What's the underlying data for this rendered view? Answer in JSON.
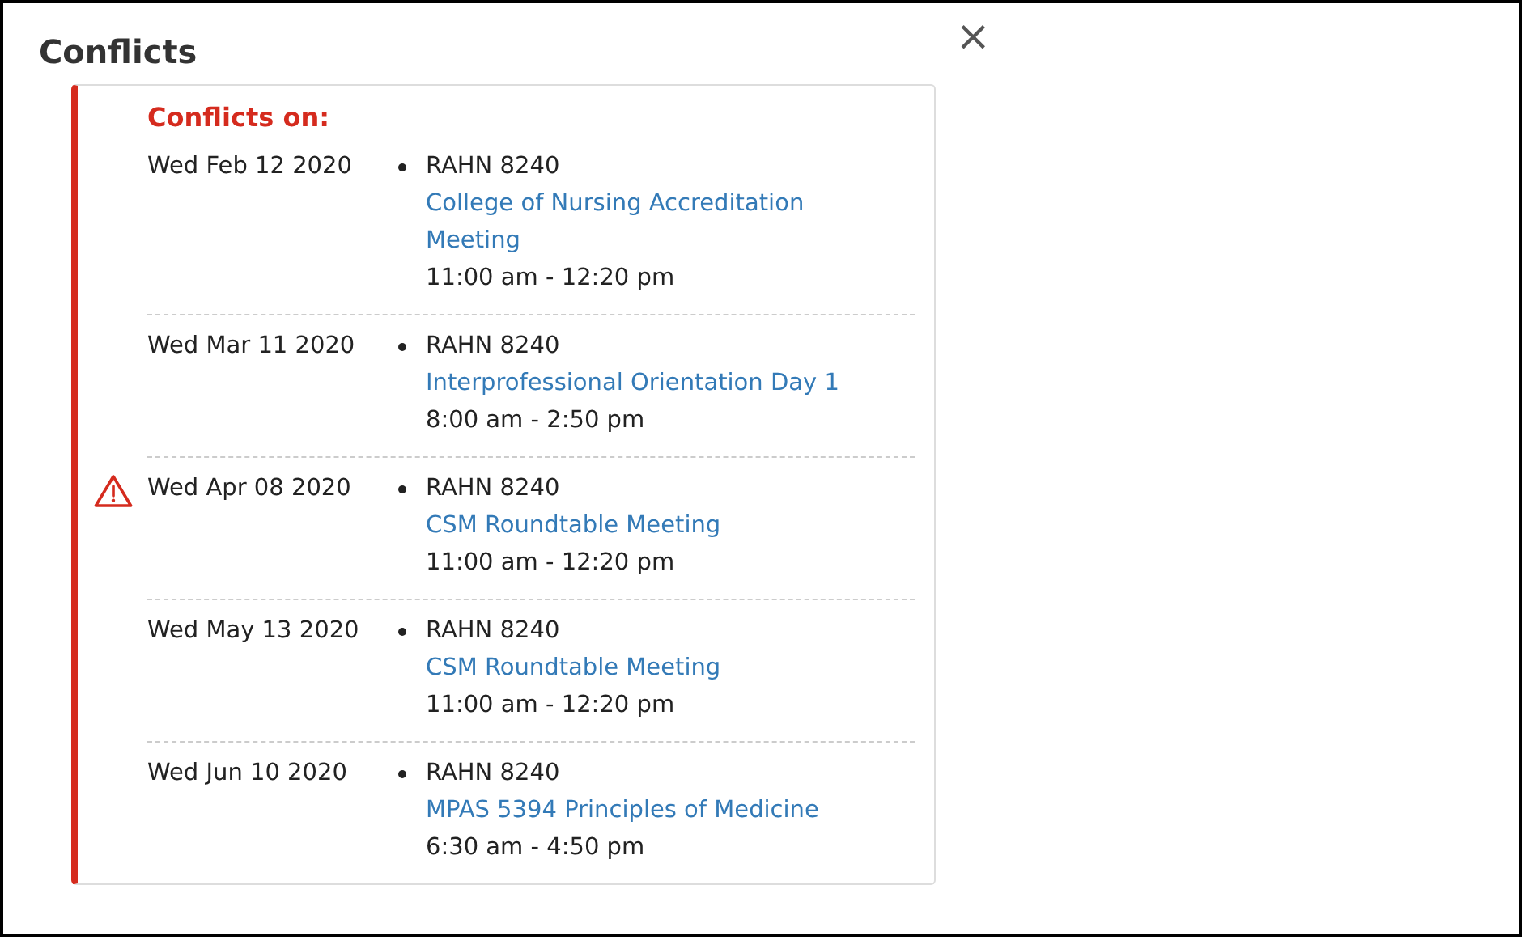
{
  "dialog": {
    "title": "Conflicts",
    "close": "×"
  },
  "conflicts": {
    "heading": "Conflicts on:",
    "rows": [
      {
        "date": "Wed Feb 12 2020",
        "warning": false,
        "location": "RAHN 8240",
        "event": "College of Nursing Accreditation Meeting",
        "time": "11:00 am - 12:20 pm"
      },
      {
        "date": "Wed Mar 11 2020",
        "warning": false,
        "location": "RAHN 8240",
        "event": "Interprofessional Orientation Day 1",
        "time": "8:00 am - 2:50 pm"
      },
      {
        "date": "Wed Apr 08 2020",
        "warning": true,
        "location": "RAHN 8240",
        "event": "CSM Roundtable Meeting",
        "time": "11:00 am - 12:20 pm"
      },
      {
        "date": "Wed May 13 2020",
        "warning": false,
        "location": "RAHN 8240",
        "event": "CSM Roundtable Meeting",
        "time": "11:00 am - 12:20 pm"
      },
      {
        "date": "Wed Jun 10 2020",
        "warning": false,
        "location": "RAHN 8240",
        "event": "MPAS 5394 Principles of Medicine",
        "time": "6:30 am - 4:50 pm"
      }
    ]
  }
}
